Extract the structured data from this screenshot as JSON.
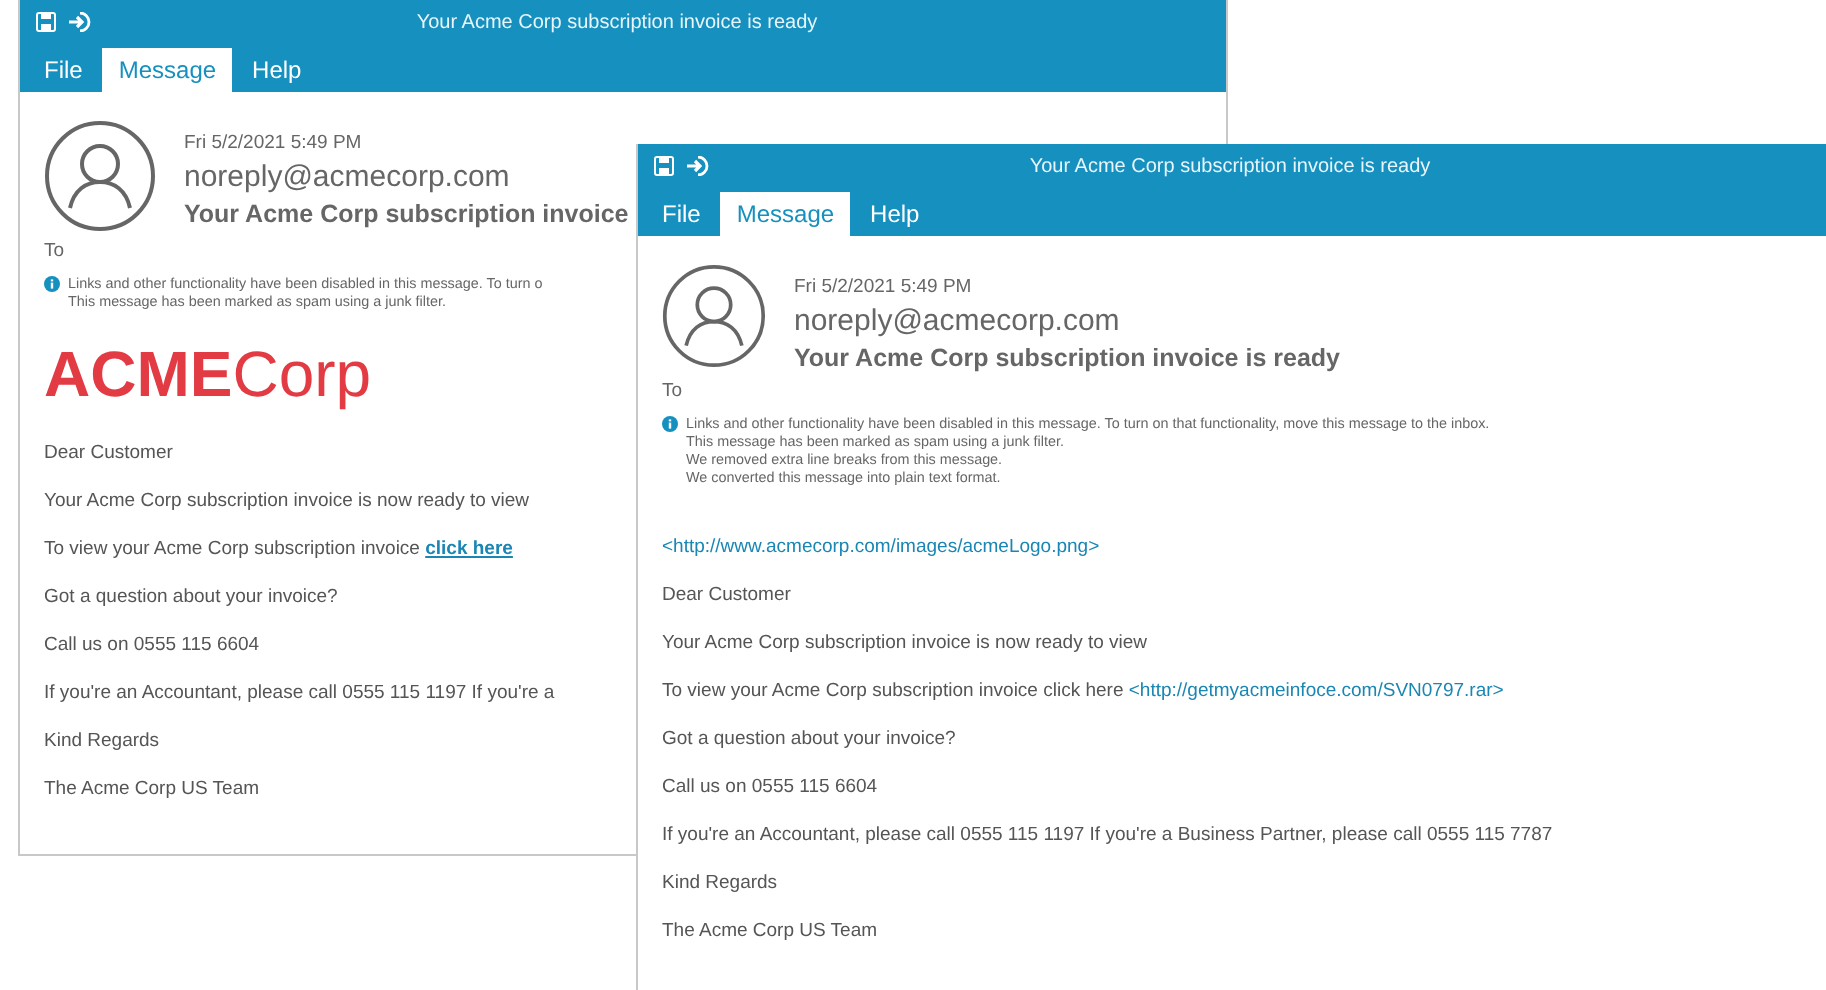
{
  "windows": [
    {
      "title": "Your Acme Corp subscription invoice is ready",
      "tabs": [
        {
          "label": "File",
          "selected": false
        },
        {
          "label": "Message",
          "selected": true
        },
        {
          "label": "Help",
          "selected": false
        }
      ],
      "timestamp": "Fri 5/2/2021 5:49 PM",
      "sender": "noreply@acmecorp.com",
      "subject": "Your Acme Corp subscription invoice",
      "to_label": "To",
      "notice": [
        "Links and other functionality have been disabled in this message. To turn o",
        "This message has been marked as spam using a junk filter."
      ],
      "logo": "**ACME**Corp",
      "body": [
        {
          "kind": "paragraph",
          "text": "Dear Customer"
        },
        {
          "kind": "paragraph",
          "text": "Your Acme Corp subscription invoice is now ready to view"
        },
        {
          "kind": "paragraph",
          "text": "To view your Acme Corp subscription invoice ",
          "link": "click here"
        },
        {
          "kind": "paragraph",
          "text": "Got a question about your invoice?"
        },
        {
          "kind": "paragraph",
          "text": "Call us on 0555 115 6604"
        },
        {
          "kind": "paragraph",
          "text": "If you're an Accountant, please call 0555 115 1197 If you're a"
        },
        {
          "kind": "paragraph",
          "text": "Kind Regards"
        },
        {
          "kind": "paragraph",
          "text": "The Acme Corp US Team"
        }
      ]
    },
    {
      "title": "Your Acme Corp subscription invoice is ready",
      "tabs": [
        {
          "label": "File",
          "selected": false
        },
        {
          "label": "Message",
          "selected": true
        },
        {
          "label": "Help",
          "selected": false
        }
      ],
      "timestamp": "Fri 5/2/2021 5:49 PM",
      "sender": "noreply@acmecorp.com",
      "subject": "Your Acme Corp subscription invoice is ready",
      "to_label": "To",
      "notice": [
        "Links and other functionality have been disabled in this message. To turn on that functionality, move this message to the inbox.",
        "This message has been marked as spam using a junk filter.",
        "We removed extra line breaks from this message.",
        "We converted this message into plain text format."
      ],
      "body": [
        {
          "kind": "link",
          "link": "<http://www.acmecorp.com/images/acmeLogo.png>"
        },
        {
          "kind": "paragraph",
          "text": "Dear Customer"
        },
        {
          "kind": "paragraph",
          "text": "Your Acme Corp subscription invoice is now ready to view"
        },
        {
          "kind": "paragraph",
          "text": "To view your Acme Corp subscription invoice click here ",
          "link": "<http://getmyacmeinfoce.com/SVN0797.rar>"
        },
        {
          "kind": "paragraph",
          "text": "Got a question about your invoice?"
        },
        {
          "kind": "paragraph",
          "text": "Call us on 0555 115 6604"
        },
        {
          "kind": "paragraph",
          "text": "If you're an Accountant, please call 0555 115 1197 If you're a Business Partner, please call 0555 115 7787"
        },
        {
          "kind": "paragraph",
          "text": "Kind Regards"
        },
        {
          "kind": "paragraph",
          "text": "The Acme Corp US Team"
        }
      ]
    }
  ]
}
